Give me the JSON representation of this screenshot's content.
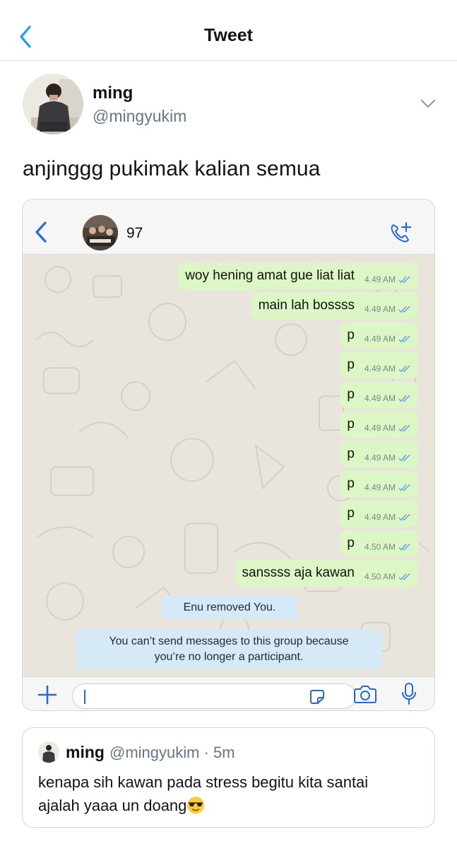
{
  "nav": {
    "title": "Tweet",
    "back_icon": "chevron-left-icon"
  },
  "author": {
    "name": "ming",
    "handle": "@mingyukim",
    "menu_icon": "chevron-down-icon"
  },
  "tweet": {
    "text": "anjinggg pukimak kalian semua"
  },
  "chat": {
    "group_name": "97",
    "call_icon": "add-call-icon",
    "messages": [
      {
        "text": "woy hening amat gue liat liat",
        "time": "4.49 AM"
      },
      {
        "text": "main lah bossss",
        "time": "4.49 AM"
      },
      {
        "text": "p",
        "time": "4.49 AM"
      },
      {
        "text": "p",
        "time": "4.49 AM"
      },
      {
        "text": "p",
        "time": "4.49 AM"
      },
      {
        "text": "p",
        "time": "4.49 AM"
      },
      {
        "text": "p",
        "time": "4.49 AM"
      },
      {
        "text": "p",
        "time": "4.49 AM"
      },
      {
        "text": "p",
        "time": "4.49 AM"
      },
      {
        "text": "p",
        "time": "4.50 AM"
      },
      {
        "text": "sanssss aja kawan",
        "time": "4.50 AM"
      }
    ],
    "system": {
      "removed": "Enu removed You.",
      "notice_line1": "You can’t send messages to this group because",
      "notice_line2": "you’re no longer a participant."
    },
    "input_icons": [
      "plus-icon",
      "sticker-icon",
      "camera-icon",
      "microphone-icon"
    ]
  },
  "quote": {
    "name": "ming",
    "handle_time": "@mingyukim · 5m",
    "line1": "kenapa sih kawan pada stress begitu kita santai",
    "line2": "ajalah yaaa un doang",
    "emoji": "sunglasses-emoji"
  },
  "colors": {
    "link_blue": "#1d9bf0",
    "ios_blue": "#2a6ad6",
    "outgoing_bubble": "#dcf7c5",
    "system_bubble": "#d6e9f7",
    "chat_background": "#e9e5dd",
    "secondary_text": "#657786"
  }
}
